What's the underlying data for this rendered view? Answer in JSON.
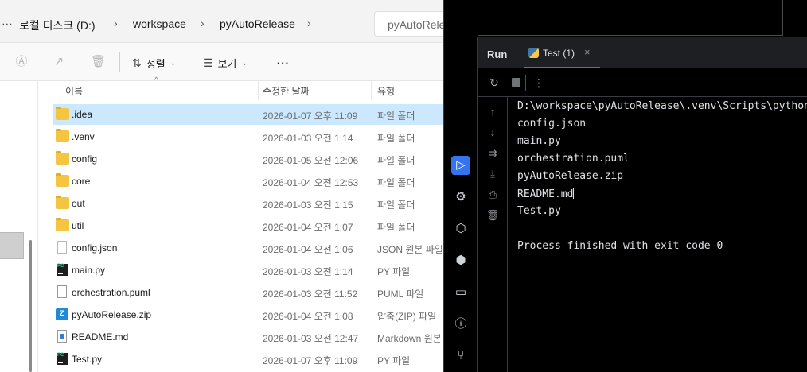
{
  "explorer": {
    "breadcrumb": [
      "로컬 디스크 (D:)",
      "workspace",
      "pyAutoRelease"
    ],
    "search_placeholder": "pyAutoRelease",
    "toolbar": {
      "sort_label": "정렬",
      "view_label": "보기",
      "more_label": "···"
    },
    "columns": {
      "name": "이름",
      "date": "수정한 날짜",
      "type": "유형"
    },
    "files": [
      {
        "name": ".idea",
        "date": "2026-01-07 오후 11:09",
        "type": "파일 폴더",
        "icon": "folder-icon",
        "selected": true
      },
      {
        "name": ".venv",
        "date": "2026-01-03 오전 1:14",
        "type": "파일 폴더",
        "icon": "folder-icon"
      },
      {
        "name": "config",
        "date": "2026-01-05 오전 12:06",
        "type": "파일 폴더",
        "icon": "folder-icon"
      },
      {
        "name": "core",
        "date": "2026-01-04 오전 12:53",
        "type": "파일 폴더",
        "icon": "folder-icon"
      },
      {
        "name": "out",
        "date": "2026-01-03 오전 1:15",
        "type": "파일 폴더",
        "icon": "folder-icon"
      },
      {
        "name": "util",
        "date": "2026-01-04 오전 1:07",
        "type": "파일 폴더",
        "icon": "folder-icon"
      },
      {
        "name": "config.json",
        "date": "2026-01-04 오전 1:06",
        "type": "JSON 원본 파일",
        "icon": "json-file-icon"
      },
      {
        "name": "main.py",
        "date": "2026-01-03 오전 1:14",
        "type": "PY 파일",
        "icon": "python-file-icon"
      },
      {
        "name": "orchestration.puml",
        "date": "2026-01-03 오전 11:52",
        "type": "PUML 파일",
        "icon": "file-icon"
      },
      {
        "name": "pyAutoRelease.zip",
        "date": "2026-01-04 오전 1:08",
        "type": "압축(ZIP) 파일",
        "icon": "zip-file-icon"
      },
      {
        "name": "README.md",
        "date": "2026-01-03 오전 12:47",
        "type": "Markdown 원본",
        "icon": "markdown-file-icon"
      },
      {
        "name": "Test.py",
        "date": "2026-01-07 오후 11:09",
        "type": "PY 파일",
        "icon": "python-file-icon"
      }
    ]
  },
  "ide": {
    "run_label": "Run",
    "tab_label": "Test (1)",
    "console_lines": [
      "D:\\workspace\\pyAutoRelease\\.venv\\Scripts\\python.exe",
      "config.json",
      "main.py",
      "orchestration.puml",
      "pyAutoRelease.zip",
      "README.md",
      "Test.py",
      "",
      "Process finished with exit code 0"
    ],
    "colors": {
      "accent": "#3574f0",
      "console_bg": "#000000",
      "text": "#dfe1e5"
    }
  }
}
